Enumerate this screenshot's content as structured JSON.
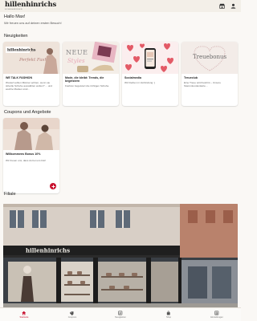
{
  "app": {
    "logo": "hillenhinrichs",
    "logo_sub": "Schuhmoden"
  },
  "greeting": {
    "title": "Hallo Max!",
    "subtitle": "Wir freuen uns auf deinen ersten Besuch!"
  },
  "news": {
    "title": "Neuigkeiten",
    "cards": [
      {
        "title": "WE TALK FASHION",
        "text": "Worauf sollten Männer achten, wenn sie stilvolle Schuhe auswählen wollen? ... und welche Marken sind...",
        "image_text": "Perfekt Fashion"
      },
      {
        "title": "Mode, die bleibt: Trends, die begeistern",
        "text": "Fashion begeistert die richtigen Schuhe.",
        "image_text": "NEUE Styles"
      },
      {
        "title": "Socialmedia",
        "text": "Wir bleiben in Verbindung :)",
        "image_text": ""
      },
      {
        "title": "Treueclub",
        "text": "Eine Treue wird belohnt – Unsere Stammkundenkarte…",
        "image_text": "Treuebonus"
      }
    ]
  },
  "coupons": {
    "title": "Coupons und Angebote",
    "items": [
      {
        "title": "Willkommens Bonus 10%",
        "text": "Wir freuen uns, dass du bei uns bist!"
      }
    ]
  },
  "store": {
    "title": "Filiale"
  },
  "nav": [
    {
      "label": "Startseite",
      "icon": "home-icon",
      "active": true
    },
    {
      "label": "Coupons",
      "icon": "coupon-icon",
      "active": false
    },
    {
      "label": "Neuigkeiten",
      "icon": "news-icon",
      "active": false
    },
    {
      "label": "Shop",
      "icon": "shop-bag-icon",
      "active": false
    },
    {
      "label": "Einstellungen",
      "icon": "settings-icon",
      "active": false
    }
  ],
  "colors": {
    "accent": "#c8102e",
    "header_bg": "#f3efe8",
    "page_bg": "#faf8f5"
  }
}
